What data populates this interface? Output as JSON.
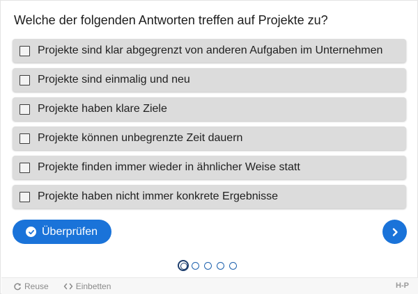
{
  "question": "Welche der folgenden Antworten treffen auf Projekte zu?",
  "answers": [
    {
      "label": "Projekte sind klar abgegrenzt von anderen Aufgaben im Unternehmen",
      "checked": false
    },
    {
      "label": "Projekte sind einmalig und neu",
      "checked": false
    },
    {
      "label": "Projekte haben klare Ziele",
      "checked": false
    },
    {
      "label": "Projekte können unbegrenzte Zeit dauern",
      "checked": false
    },
    {
      "label": "Projekte finden immer wieder in ähnlicher Weise statt",
      "checked": false
    },
    {
      "label": "Projekte haben nicht immer konkrete Ergebnisse",
      "checked": false
    }
  ],
  "check_button": {
    "label": "Überprüfen",
    "icon": "check-circle-icon"
  },
  "next_button": {
    "icon": "chevron-right-icon"
  },
  "progress": {
    "total": 5,
    "current": 1
  },
  "footer": {
    "reuse_label": "Reuse",
    "embed_label": "Einbetten",
    "logo": "H-P"
  },
  "colors": {
    "accent": "#1a73d9",
    "answer_bg": "#dcdcdc",
    "footer_bg": "#f7f7f7"
  }
}
